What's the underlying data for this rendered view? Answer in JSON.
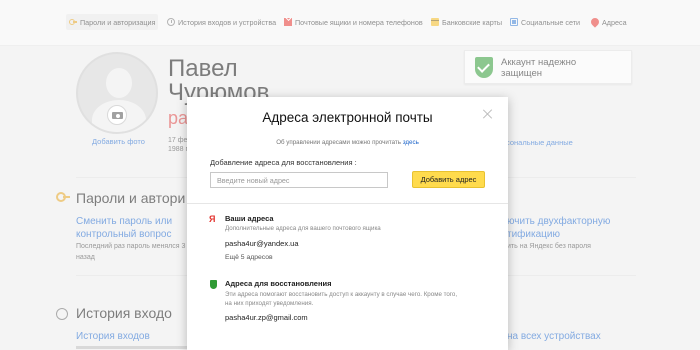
{
  "nav": {
    "items": [
      {
        "label": "Пароли и авторизация",
        "icon": "key-icon"
      },
      {
        "label": "История входов и устройства",
        "icon": "clock-icon"
      },
      {
        "label": "Почтовые ящики и номера телефонов",
        "icon": "mail-icon"
      },
      {
        "label": "Банковские карты",
        "icon": "card-icon"
      },
      {
        "label": "Социальные сети",
        "icon": "social-icon"
      },
      {
        "label": "Адреса",
        "icon": "pin-icon"
      }
    ]
  },
  "profile": {
    "first_name": "Павел",
    "last_name": "Чурюмов",
    "login_partial": "pas",
    "add_photo": "Добавить фото",
    "bday_line1": "17 фе",
    "bday_line2": "1988 г"
  },
  "security_badge": {
    "line1": "Аккаунт надежно",
    "line2": "защищен"
  },
  "personal_data_link": "сональные данные",
  "passwords_section": {
    "title": "Пароли и автори",
    "change_link_1": "Сменить пароль или",
    "change_link_2": "контрольный вопрос",
    "last_change_1": "Последний раз пароль менялся 3",
    "last_change_2": "назад",
    "twofa_1": "ючить двухфакторную",
    "twofa_2": "тификацию",
    "twofa_note": "ить на Яндекс без пароля"
  },
  "history_section": {
    "title": "История входо",
    "history_link": "История входов",
    "all_devices": "на всех устройствах"
  },
  "modal": {
    "title": "Адреса электронной почты",
    "info_text": "Об управлении адресами можно прочитать",
    "info_link": "здесь",
    "add_label": "Добавление адреса для восстановления :",
    "input_placeholder": "Введите новый адрес",
    "add_button": "Добавить адрес",
    "your_addresses_title": "Ваши адреса",
    "your_addresses_desc": "Дополнительные адреса для вашего почтового ящика",
    "your_email": "pasha4ur@yandex.ua",
    "more_link": "Ещё 5 адресов",
    "recovery_title": "Адреса для восстановления",
    "recovery_desc_1": "Эти адреса помогают восстановить доступ к аккаунту в случае чего. Кроме того,",
    "recovery_desc_2": "на них приходят уведомления.",
    "recovery_email": "pasha4ur.zp@gmail.com"
  },
  "colors": {
    "link": "#1a63c9",
    "accent_button": "#ffdb4d",
    "shield_green": "#2f9a34",
    "login_red": "#d94141"
  }
}
